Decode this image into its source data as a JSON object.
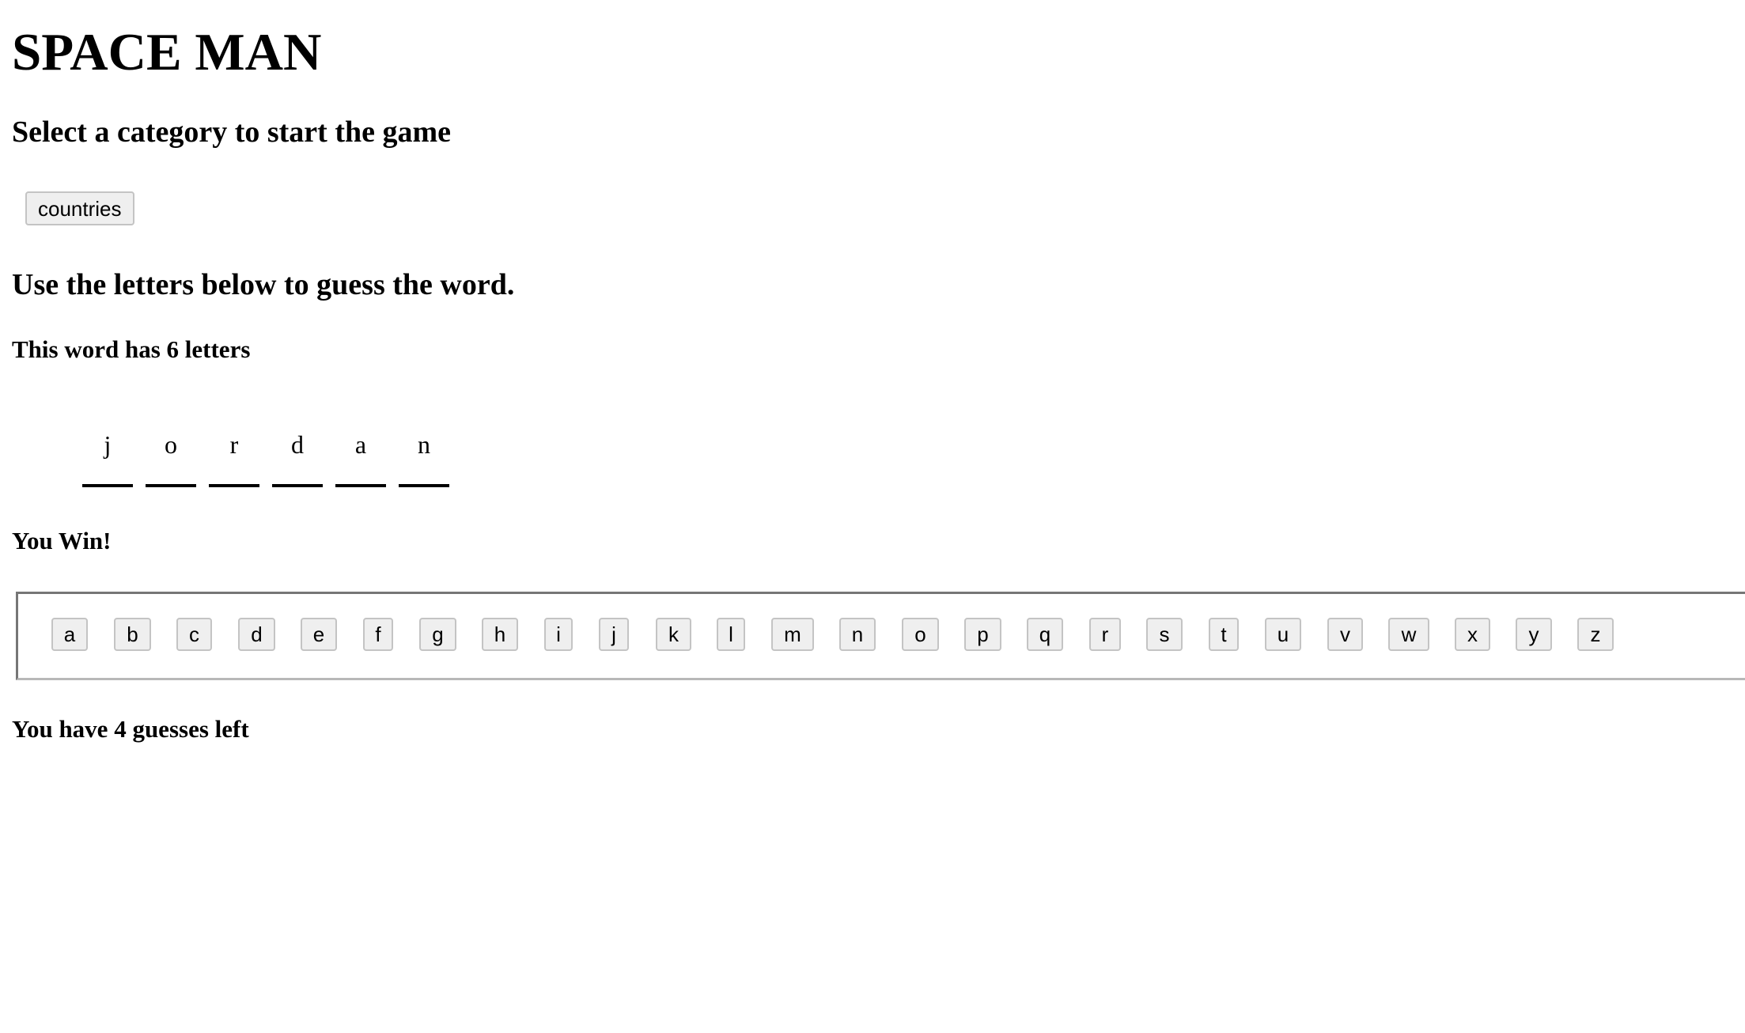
{
  "header": {
    "title": "SPACE MAN",
    "subtitle": "Select a category to start the game"
  },
  "categories": [
    {
      "label": "countries"
    }
  ],
  "instructions": "Use the letters below to guess the word.",
  "word_info": "This word has 6 letters",
  "word": {
    "letters": [
      "j",
      "o",
      "r",
      "d",
      "a",
      "n"
    ]
  },
  "status": {
    "result": "You Win!",
    "guesses_left": "You have 4 guesses left"
  },
  "keyboard": {
    "keys": [
      "a",
      "b",
      "c",
      "d",
      "e",
      "f",
      "g",
      "h",
      "i",
      "j",
      "k",
      "l",
      "m",
      "n",
      "o",
      "p",
      "q",
      "r",
      "s",
      "t",
      "u",
      "v",
      "w",
      "x",
      "y",
      "z"
    ]
  }
}
